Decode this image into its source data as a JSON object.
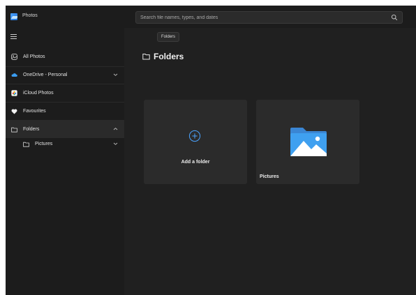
{
  "app": {
    "title": "Photos"
  },
  "search": {
    "placeholder": "Search file names, types, and dates"
  },
  "tooltip": {
    "text": "Folders"
  },
  "sidebar": {
    "items": [
      {
        "label": "All Photos",
        "icon": "photos-icon"
      },
      {
        "label": "OneDrive - Personal",
        "icon": "cloud-icon",
        "chevron": "down"
      },
      {
        "label": "iCloud Photos",
        "icon": "icloud-icon"
      },
      {
        "label": "Favourites",
        "icon": "heart-icon"
      },
      {
        "label": "Folders",
        "icon": "folder-icon",
        "chevron": "up",
        "selected": true
      },
      {
        "label": "Pictures",
        "icon": "folder-icon",
        "chevron": "down"
      }
    ]
  },
  "main": {
    "title": "Folders",
    "cards": [
      {
        "label": "Add a folder",
        "icon": "plus-circle-icon"
      },
      {
        "label": "Pictures",
        "icon": "pictures-folder-icon"
      }
    ]
  },
  "colors": {
    "accent": "#4aa3ff",
    "background": "#202020",
    "sidebar": "#1c1c1c",
    "card": "#2b2b2b"
  }
}
